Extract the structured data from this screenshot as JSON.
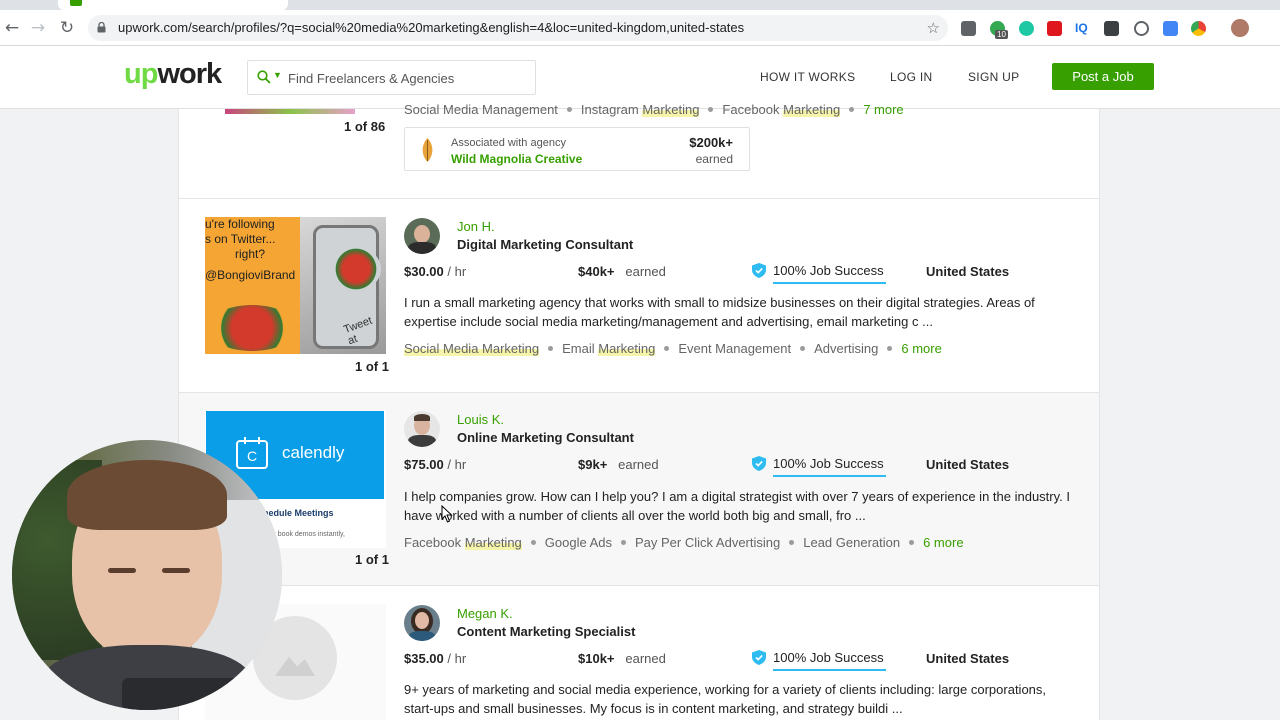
{
  "browser": {
    "url": "upwork.com/search/profiles/?q=social%20media%20marketing&english=4&loc=united-kingdom,united-states",
    "extension_badge": "10"
  },
  "header": {
    "logo_up": "up",
    "logo_work": "work",
    "search_placeholder": "Find Freelancers & Agencies",
    "nav": {
      "how_it_works": "HOW IT WORKS",
      "log_in": "LOG IN",
      "sign_up": "SIGN UP"
    },
    "post_job": "Post a Job"
  },
  "colors": {
    "brand_green": "#37a000",
    "logo_green": "#6fda44",
    "job_success_blue": "#2ebcf0",
    "highlight_yellow": "#f5f4a8"
  },
  "top_card": {
    "skills": [
      {
        "pre": "Social Media Management",
        "hl": ""
      },
      {
        "pre": "Instagram ",
        "hl": "Marketing"
      },
      {
        "pre": "Facebook ",
        "hl": "Marketing"
      }
    ],
    "more": "7 more",
    "counter": "1 of 86",
    "agency": {
      "associated": "Associated with agency",
      "name": "Wild Magnolia Creative",
      "earned_amount": "$200k+",
      "earned_label": "earned"
    }
  },
  "freelancers": [
    {
      "name": "Jon H.",
      "title": "Digital Marketing Consultant",
      "rate": "$30.00",
      "rate_unit": " / hr",
      "earned": "$40k+",
      "earned_label": "earned",
      "job_success": "100% Job Success",
      "country": "United States",
      "description": "I run a small marketing agency that works with small to midsize businesses on their digital strategies. Areas of expertise include social media marketing/management and advertising, email marketing c ...",
      "skills": [
        {
          "pre": "",
          "hl": "Social Media Marketing"
        },
        {
          "pre": "Email ",
          "hl": "Marketing"
        },
        {
          "pre": "Event Management",
          "hl": ""
        },
        {
          "pre": "Advertising",
          "hl": ""
        }
      ],
      "more": "6 more",
      "counter": "1 of 1",
      "portfolio_text": [
        "u're following",
        "s on Twitter...",
        "right?",
        "@BongioviBrand"
      ],
      "portfolio_phone_text": "Tweet at"
    },
    {
      "name": "Louis K.",
      "title": "Online Marketing Consultant",
      "rate": "$75.00",
      "rate_unit": " / hr",
      "earned": "$9k+",
      "earned_label": "earned",
      "job_success": "100% Job Success",
      "country": "United States",
      "description": "I help companies grow. How can I help you? I am a digital strategist with over 7 years of experience in the industry. I have worked with a number of clients all over the world both big and small, fro ...",
      "skills": [
        {
          "pre": "Facebook ",
          "hl": "Marketing"
        },
        {
          "pre": "Google Ads",
          "hl": ""
        },
        {
          "pre": "Pay Per Click Advertising",
          "hl": ""
        },
        {
          "pre": "Lead Generation",
          "hl": ""
        }
      ],
      "more": "6 more",
      "counter": "1 of 1",
      "portfolio_brand": "calendly",
      "portfolio_text": [
        "hedule Meetings",
        "ects book demos instantly,"
      ]
    },
    {
      "name": "Megan K.",
      "title": "Content Marketing Specialist",
      "rate": "$35.00",
      "rate_unit": " / hr",
      "earned": "$10k+",
      "earned_label": "earned",
      "job_success": "100% Job Success",
      "country": "United States",
      "description": "9+ years of marketing and social media experience, working for a variety of clients including: large corporations, start-ups and small businesses. My focus is in content marketing, and strategy buildi ..."
    }
  ]
}
